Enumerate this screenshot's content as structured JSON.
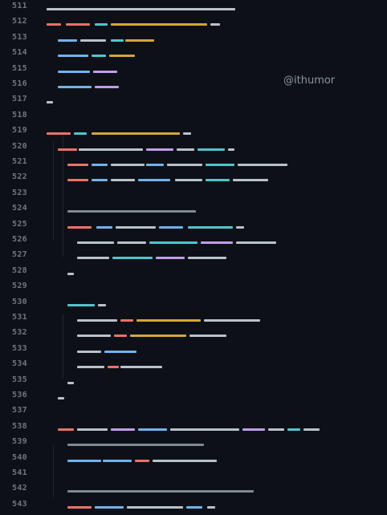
{
  "editor": {
    "theme": {
      "background": "#0d1117",
      "line_number_color": "#6e7681"
    },
    "watermark": "@ithumor",
    "lines": [
      {
        "n": "511",
        "code": "#[...]"
      },
      {
        "n": "512",
        "code": ""
      },
      {
        "n": "513",
        "code": ""
      },
      {
        "n": "514",
        "code": ""
      },
      {
        "n": "515",
        "code": ""
      },
      {
        "n": "516",
        "code": ""
      },
      {
        "n": "517",
        "code": "}"
      },
      {
        "n": "518",
        "code": ""
      },
      {
        "n": "519",
        "code": ""
      },
      {
        "n": "520",
        "code": ""
      },
      {
        "n": "521",
        "code": ""
      },
      {
        "n": "522",
        "code": ""
      },
      {
        "n": "523",
        "code": ""
      },
      {
        "n": "524",
        "code": ""
      },
      {
        "n": "525",
        "code": ""
      },
      {
        "n": "526",
        "code": ""
      },
      {
        "n": "527",
        "code": ""
      },
      {
        "n": "528",
        "code": "}"
      },
      {
        "n": "529",
        "code": ""
      },
      {
        "n": "530",
        "code": ""
      },
      {
        "n": "531",
        "code": ""
      },
      {
        "n": "532",
        "code": ""
      },
      {
        "n": "533",
        "code": ""
      },
      {
        "n": "534",
        "code": ""
      },
      {
        "n": "535",
        "code": "}"
      },
      {
        "n": "536",
        "code": "}"
      },
      {
        "n": "537",
        "code": ""
      },
      {
        "n": "538",
        "code": ""
      },
      {
        "n": "539",
        "code": ""
      },
      {
        "n": "540",
        "code": ""
      },
      {
        "n": "541",
        "code": ""
      },
      {
        "n": "542",
        "code": ""
      },
      {
        "n": "543",
        "code": ""
      }
    ]
  }
}
